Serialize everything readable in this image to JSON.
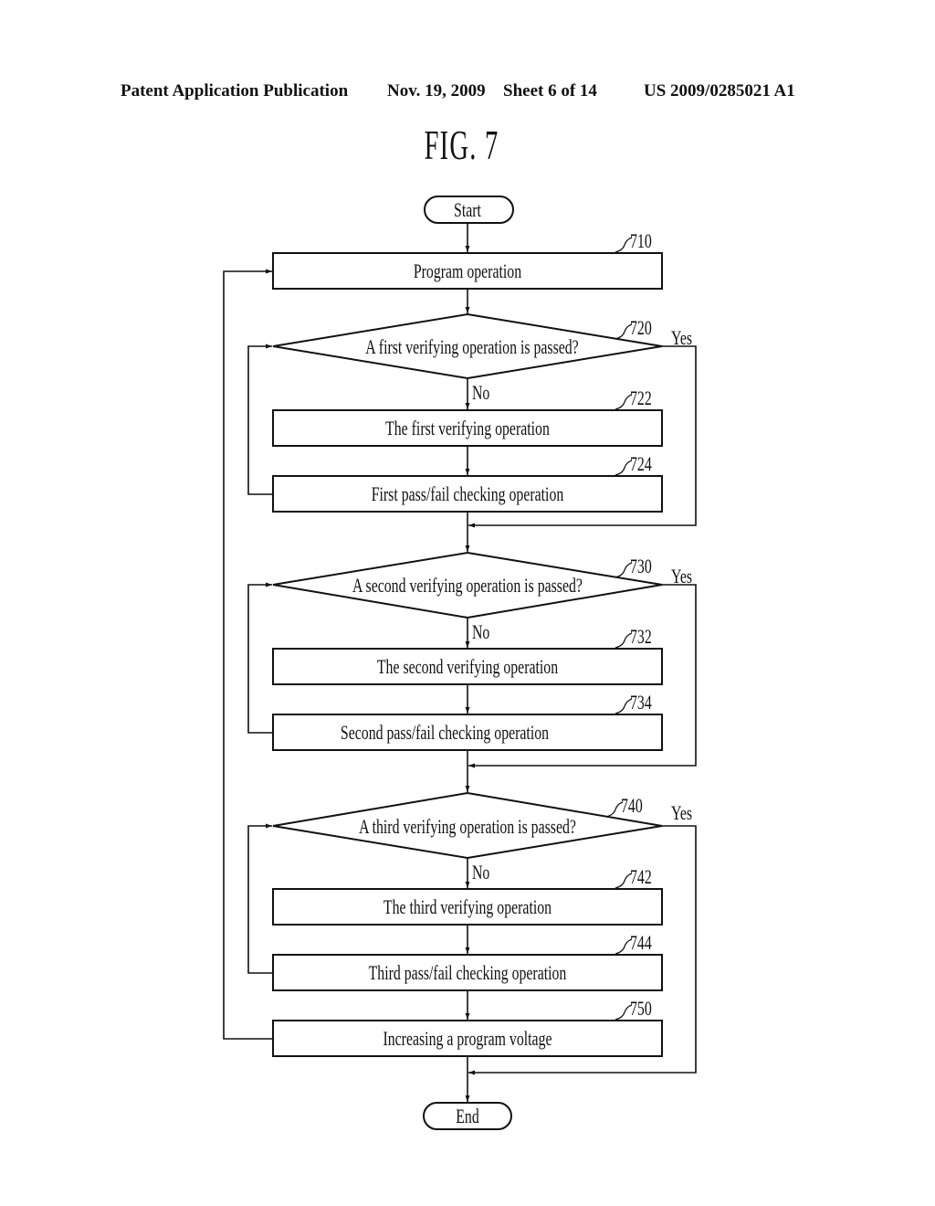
{
  "header": {
    "publication_type": "Patent Application Publication",
    "date": "Nov. 19, 2009",
    "sheet": "Sheet 6 of 14",
    "patent_number": "US 2009/0285021 A1"
  },
  "figure": {
    "title": "FIG. 7"
  },
  "flowchart": {
    "start": {
      "label": "Start"
    },
    "end": {
      "label": "End"
    },
    "steps": [
      {
        "id": "710",
        "ref": "710",
        "type": "process",
        "label": "Program operation"
      },
      {
        "id": "720",
        "ref": "720",
        "type": "decision",
        "label": "A first verifying operation is passed?"
      },
      {
        "id": "722",
        "ref": "722",
        "type": "process",
        "label": "The first verifying operation"
      },
      {
        "id": "724",
        "ref": "724",
        "type": "process",
        "label": "First pass/fail checking operation"
      },
      {
        "id": "730",
        "ref": "730",
        "type": "decision",
        "label": "A second verifying operation is passed?"
      },
      {
        "id": "732",
        "ref": "732",
        "type": "process",
        "label": "The second verifying operation"
      },
      {
        "id": "734",
        "ref": "734",
        "type": "process",
        "label": "Second pass/fail checking operation"
      },
      {
        "id": "740",
        "ref": "740",
        "type": "decision",
        "label": "A third verifying operation is passed?"
      },
      {
        "id": "742",
        "ref": "742",
        "type": "process",
        "label": "The third verifying operation"
      },
      {
        "id": "744",
        "ref": "744",
        "type": "process",
        "label": "Third pass/fail checking operation"
      },
      {
        "id": "750",
        "ref": "750",
        "type": "process",
        "label": "Increasing a program voltage"
      }
    ],
    "branch_labels": {
      "yes": "Yes",
      "no": "No"
    },
    "edges": [
      {
        "from": "start",
        "to": "710"
      },
      {
        "from": "710",
        "to": "720"
      },
      {
        "from": "720",
        "to": "722",
        "label": "No"
      },
      {
        "from": "720",
        "to": "730",
        "label": "Yes"
      },
      {
        "from": "722",
        "to": "724"
      },
      {
        "from": "724",
        "to": "720"
      },
      {
        "from": "724",
        "to": "730"
      },
      {
        "from": "730",
        "to": "732",
        "label": "No"
      },
      {
        "from": "730",
        "to": "740",
        "label": "Yes"
      },
      {
        "from": "732",
        "to": "734"
      },
      {
        "from": "734",
        "to": "730"
      },
      {
        "from": "734",
        "to": "740"
      },
      {
        "from": "740",
        "to": "742",
        "label": "No"
      },
      {
        "from": "740",
        "to": "end",
        "label": "Yes"
      },
      {
        "from": "742",
        "to": "744"
      },
      {
        "from": "744",
        "to": "740"
      },
      {
        "from": "744",
        "to": "750"
      },
      {
        "from": "750",
        "to": "710"
      },
      {
        "from": "750",
        "to": "end"
      }
    ]
  }
}
